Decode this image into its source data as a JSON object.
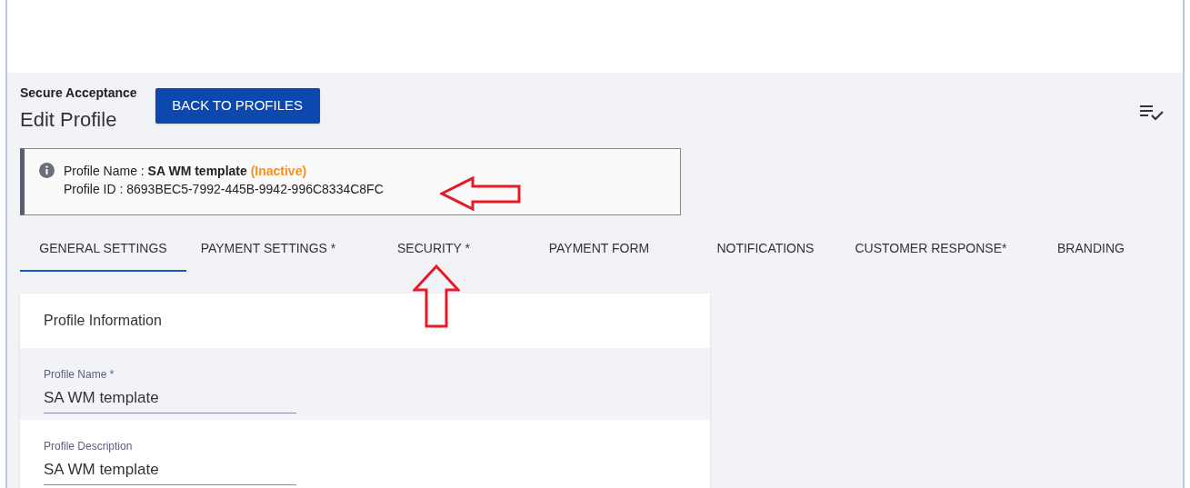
{
  "header": {
    "subtitle": "Secure Acceptance",
    "title": "Edit Profile",
    "back_button": "BACK TO PROFILES"
  },
  "info": {
    "name_label": "Profile Name : ",
    "name_value": "SA WM template",
    "status": "(Inactive)",
    "id_line": "Profile ID : 8693BEC5-7992-445B-9942-996C8334C8FC"
  },
  "tabs": [
    {
      "label": "GENERAL SETTINGS",
      "selected": true
    },
    {
      "label": "PAYMENT SETTINGS *",
      "selected": false
    },
    {
      "label": "SECURITY *",
      "selected": false
    },
    {
      "label": "PAYMENT FORM",
      "selected": false
    },
    {
      "label": "NOTIFICATIONS",
      "selected": false
    },
    {
      "label": "CUSTOMER RESPONSE*",
      "selected": false
    },
    {
      "label": "BRANDING",
      "selected": false
    }
  ],
  "card": {
    "title": "Profile Information",
    "fields": [
      {
        "label": "Profile Name *",
        "value": "SA WM template"
      },
      {
        "label": "Profile Description",
        "value": "SA WM template"
      }
    ]
  }
}
